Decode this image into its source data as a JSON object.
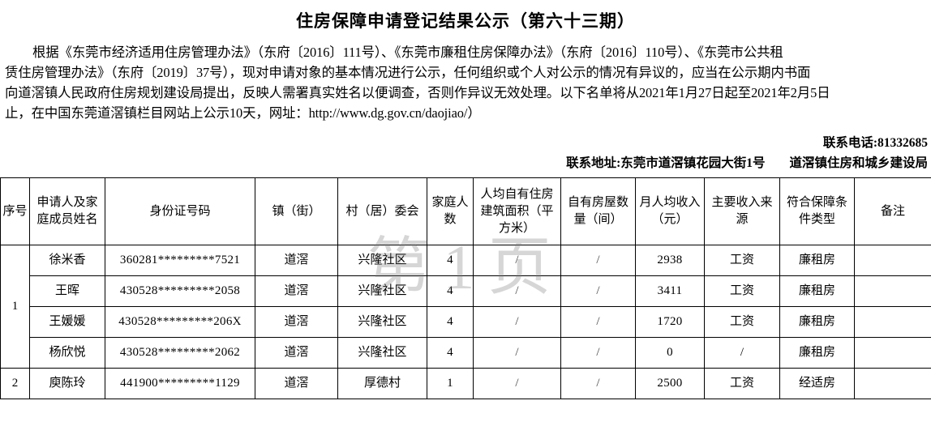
{
  "document": {
    "title": "住房保障申请登记结果公示（第六十三期）"
  },
  "body": {
    "lines": [
      "根据《东莞市经济适用住房管理办法》（东府〔2016〕111号）、《东莞市廉租住房保障办法》（东府〔2016〕110号）、《东莞市公共租",
      "赁住房管理办法》（东府〔2019〕37号），现对申请对象的基本情况进行公示，任何组织或个人对公示的情况有异议的，应当在公示期内书面",
      "向道滘镇人民政府住房规划建设局提出，反映人需署真实姓名以便调查，否则作异议无效处理。以下名单将从2021年1月27日起至2021年2月5日",
      "止，在中国东莞道滘镇栏目网站上公示10天，网址：http://www.dg.gov.cn/daojiao/）"
    ]
  },
  "contact": {
    "phone_line": "联系电话:81332685",
    "address_label": "联系地址:东莞市道滘镇花园大街1号",
    "department": "道滘镇住房和城乡建设局"
  },
  "watermark": {
    "text": "第1页"
  },
  "table": {
    "headers": [
      "序号",
      "申请人及家庭成员姓名",
      "身份证号码",
      "镇（街）",
      "村（居）委会",
      "家庭人数",
      "人均自有住房建筑面积（平方米）",
      "自有房屋数量（间）",
      "月人均收入（元）",
      "主要收入来源",
      "符合保障条件类型",
      "备注"
    ],
    "rows": [
      {
        "seq": "1",
        "seq_rowspan": 4,
        "name": "徐米香",
        "id": "360281*********7521",
        "town": "道滘",
        "village": "兴隆社区",
        "family_size": "4",
        "area_per_capita": "/",
        "rooms": "/",
        "income": "2938",
        "income_source": "工资",
        "housing_type": "廉租房",
        "remark": ""
      },
      {
        "seq": "",
        "seq_rowspan": 0,
        "name": "王晖",
        "id": "430528*********2058",
        "town": "道滘",
        "village": "兴隆社区",
        "family_size": "4",
        "area_per_capita": "/",
        "rooms": "/",
        "income": "3411",
        "income_source": "工资",
        "housing_type": "廉租房",
        "remark": ""
      },
      {
        "seq": "",
        "seq_rowspan": 0,
        "name": "王媛媛",
        "id": "430528*********206X",
        "town": "道滘",
        "village": "兴隆社区",
        "family_size": "4",
        "area_per_capita": "/",
        "rooms": "/",
        "income": "1720",
        "income_source": "工资",
        "housing_type": "廉租房",
        "remark": ""
      },
      {
        "seq": "",
        "seq_rowspan": 0,
        "name": "杨欣悦",
        "id": "430528*********2062",
        "town": "道滘",
        "village": "兴隆社区",
        "family_size": "4",
        "area_per_capita": "/",
        "rooms": "/",
        "income": "0",
        "income_source": "/",
        "housing_type": "廉租房",
        "remark": ""
      },
      {
        "seq": "2",
        "seq_rowspan": 1,
        "name": "庾陈玲",
        "id": "441900*********1129",
        "town": "道滘",
        "village": "厚德村",
        "family_size": "1",
        "area_per_capita": "/",
        "rooms": "/",
        "income": "2500",
        "income_source": "工资",
        "housing_type": "经适房",
        "remark": ""
      }
    ]
  }
}
